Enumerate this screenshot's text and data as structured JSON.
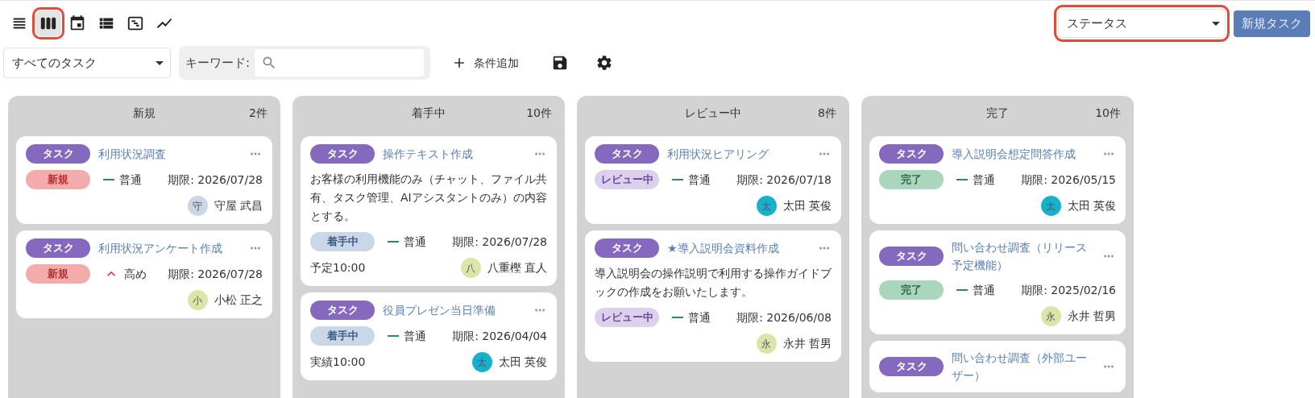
{
  "view_buttons": [
    {
      "kind": "list",
      "selected": false,
      "highlighted": false
    },
    {
      "kind": "board",
      "selected": true,
      "highlighted": true
    },
    {
      "kind": "calendar",
      "selected": false,
      "highlighted": false
    },
    {
      "kind": "table",
      "selected": false,
      "highlighted": false
    },
    {
      "kind": "timeline",
      "selected": false,
      "highlighted": false
    },
    {
      "kind": "chart",
      "selected": false,
      "highlighted": false
    }
  ],
  "group_by": {
    "value": "ステータス",
    "highlighted": true
  },
  "new_task_button": "新規タスク",
  "filter_select": "すべてのタスク",
  "keyword": {
    "label": "キーワード:"
  },
  "add_condition": "条件追加",
  "columns": [
    {
      "title": "新規",
      "count": "2件",
      "cards": [
        {
          "tag": "タスク",
          "title": "利用状況調査",
          "status": {
            "label": "新規",
            "kind": "new"
          },
          "priority": {
            "label": "普通",
            "kind": "normal"
          },
          "due": "期限: 2026/07/28",
          "assignee": {
            "initial": "守",
            "name": "守屋 武昌",
            "color": "#c9d6e6"
          }
        },
        {
          "tag": "タスク",
          "title": "利用状況アンケート作成",
          "status": {
            "label": "新規",
            "kind": "new"
          },
          "priority": {
            "label": "高め",
            "kind": "high"
          },
          "due": "期限: 2026/07/28",
          "assignee": {
            "initial": "小",
            "name": "小松 正之",
            "color": "#d9e6a8"
          }
        }
      ]
    },
    {
      "title": "着手中",
      "count": "10件",
      "cards": [
        {
          "tag": "タスク",
          "title": "操作テキスト作成",
          "description": "お客様の利用機能のみ（チャット、ファイル共有、タスク管理、AIアシスタントのみ）の内容とする。",
          "status": {
            "label": "着手中",
            "kind": "in_progress"
          },
          "priority": {
            "label": "普通",
            "kind": "normal"
          },
          "due": "期限: 2026/07/28",
          "note": "予定10:00",
          "assignee": {
            "initial": "八",
            "name": "八重樫 直人",
            "color": "#d9e6a8"
          }
        },
        {
          "tag": "タスク",
          "title": "役員プレゼン当日準備",
          "status": {
            "label": "着手中",
            "kind": "in_progress"
          },
          "priority": {
            "label": "普通",
            "kind": "normal"
          },
          "due": "期限: 2026/04/04",
          "note": "実績10:00",
          "assignee": {
            "initial": "太",
            "name": "太田 英俊",
            "color": "#17b1cc"
          }
        }
      ]
    },
    {
      "title": "レビュー中",
      "count": "8件",
      "cards": [
        {
          "tag": "タスク",
          "title": "利用状況ヒアリング",
          "status": {
            "label": "レビュー中",
            "kind": "review"
          },
          "priority": {
            "label": "普通",
            "kind": "normal"
          },
          "due": "期限: 2026/07/18",
          "assignee": {
            "initial": "太",
            "name": "太田 英俊",
            "color": "#17b1cc"
          }
        },
        {
          "tag": "タスク",
          "title": "★導入説明会資料作成",
          "description": "導入説明会の操作説明で利用する操作ガイドブックの作成をお願いたします。",
          "status": {
            "label": "レビュー中",
            "kind": "review"
          },
          "priority": {
            "label": "普通",
            "kind": "normal"
          },
          "due": "期限: 2026/06/08",
          "assignee": {
            "initial": "永",
            "name": "永井 哲男",
            "color": "#d9e6a8"
          }
        }
      ]
    },
    {
      "title": "完了",
      "count": "10件",
      "cards": [
        {
          "tag": "タスク",
          "title": "導入説明会想定問答作成",
          "status": {
            "label": "完了",
            "kind": "done"
          },
          "priority": {
            "label": "普通",
            "kind": "normal"
          },
          "due": "期限: 2026/05/15",
          "assignee": {
            "initial": "太",
            "name": "太田 英俊",
            "color": "#17b1cc"
          }
        },
        {
          "tag": "タスク",
          "title": "問い合わせ調査（リリース予定機能）",
          "status": {
            "label": "完了",
            "kind": "done"
          },
          "priority": {
            "label": "普通",
            "kind": "normal"
          },
          "due": "期限: 2025/02/16",
          "assignee": {
            "initial": "永",
            "name": "永井 哲男",
            "color": "#d9e6a8"
          }
        },
        {
          "tag": "タスク",
          "title": "問い合わせ調査（外部ユーザー）"
        }
      ]
    }
  ]
}
